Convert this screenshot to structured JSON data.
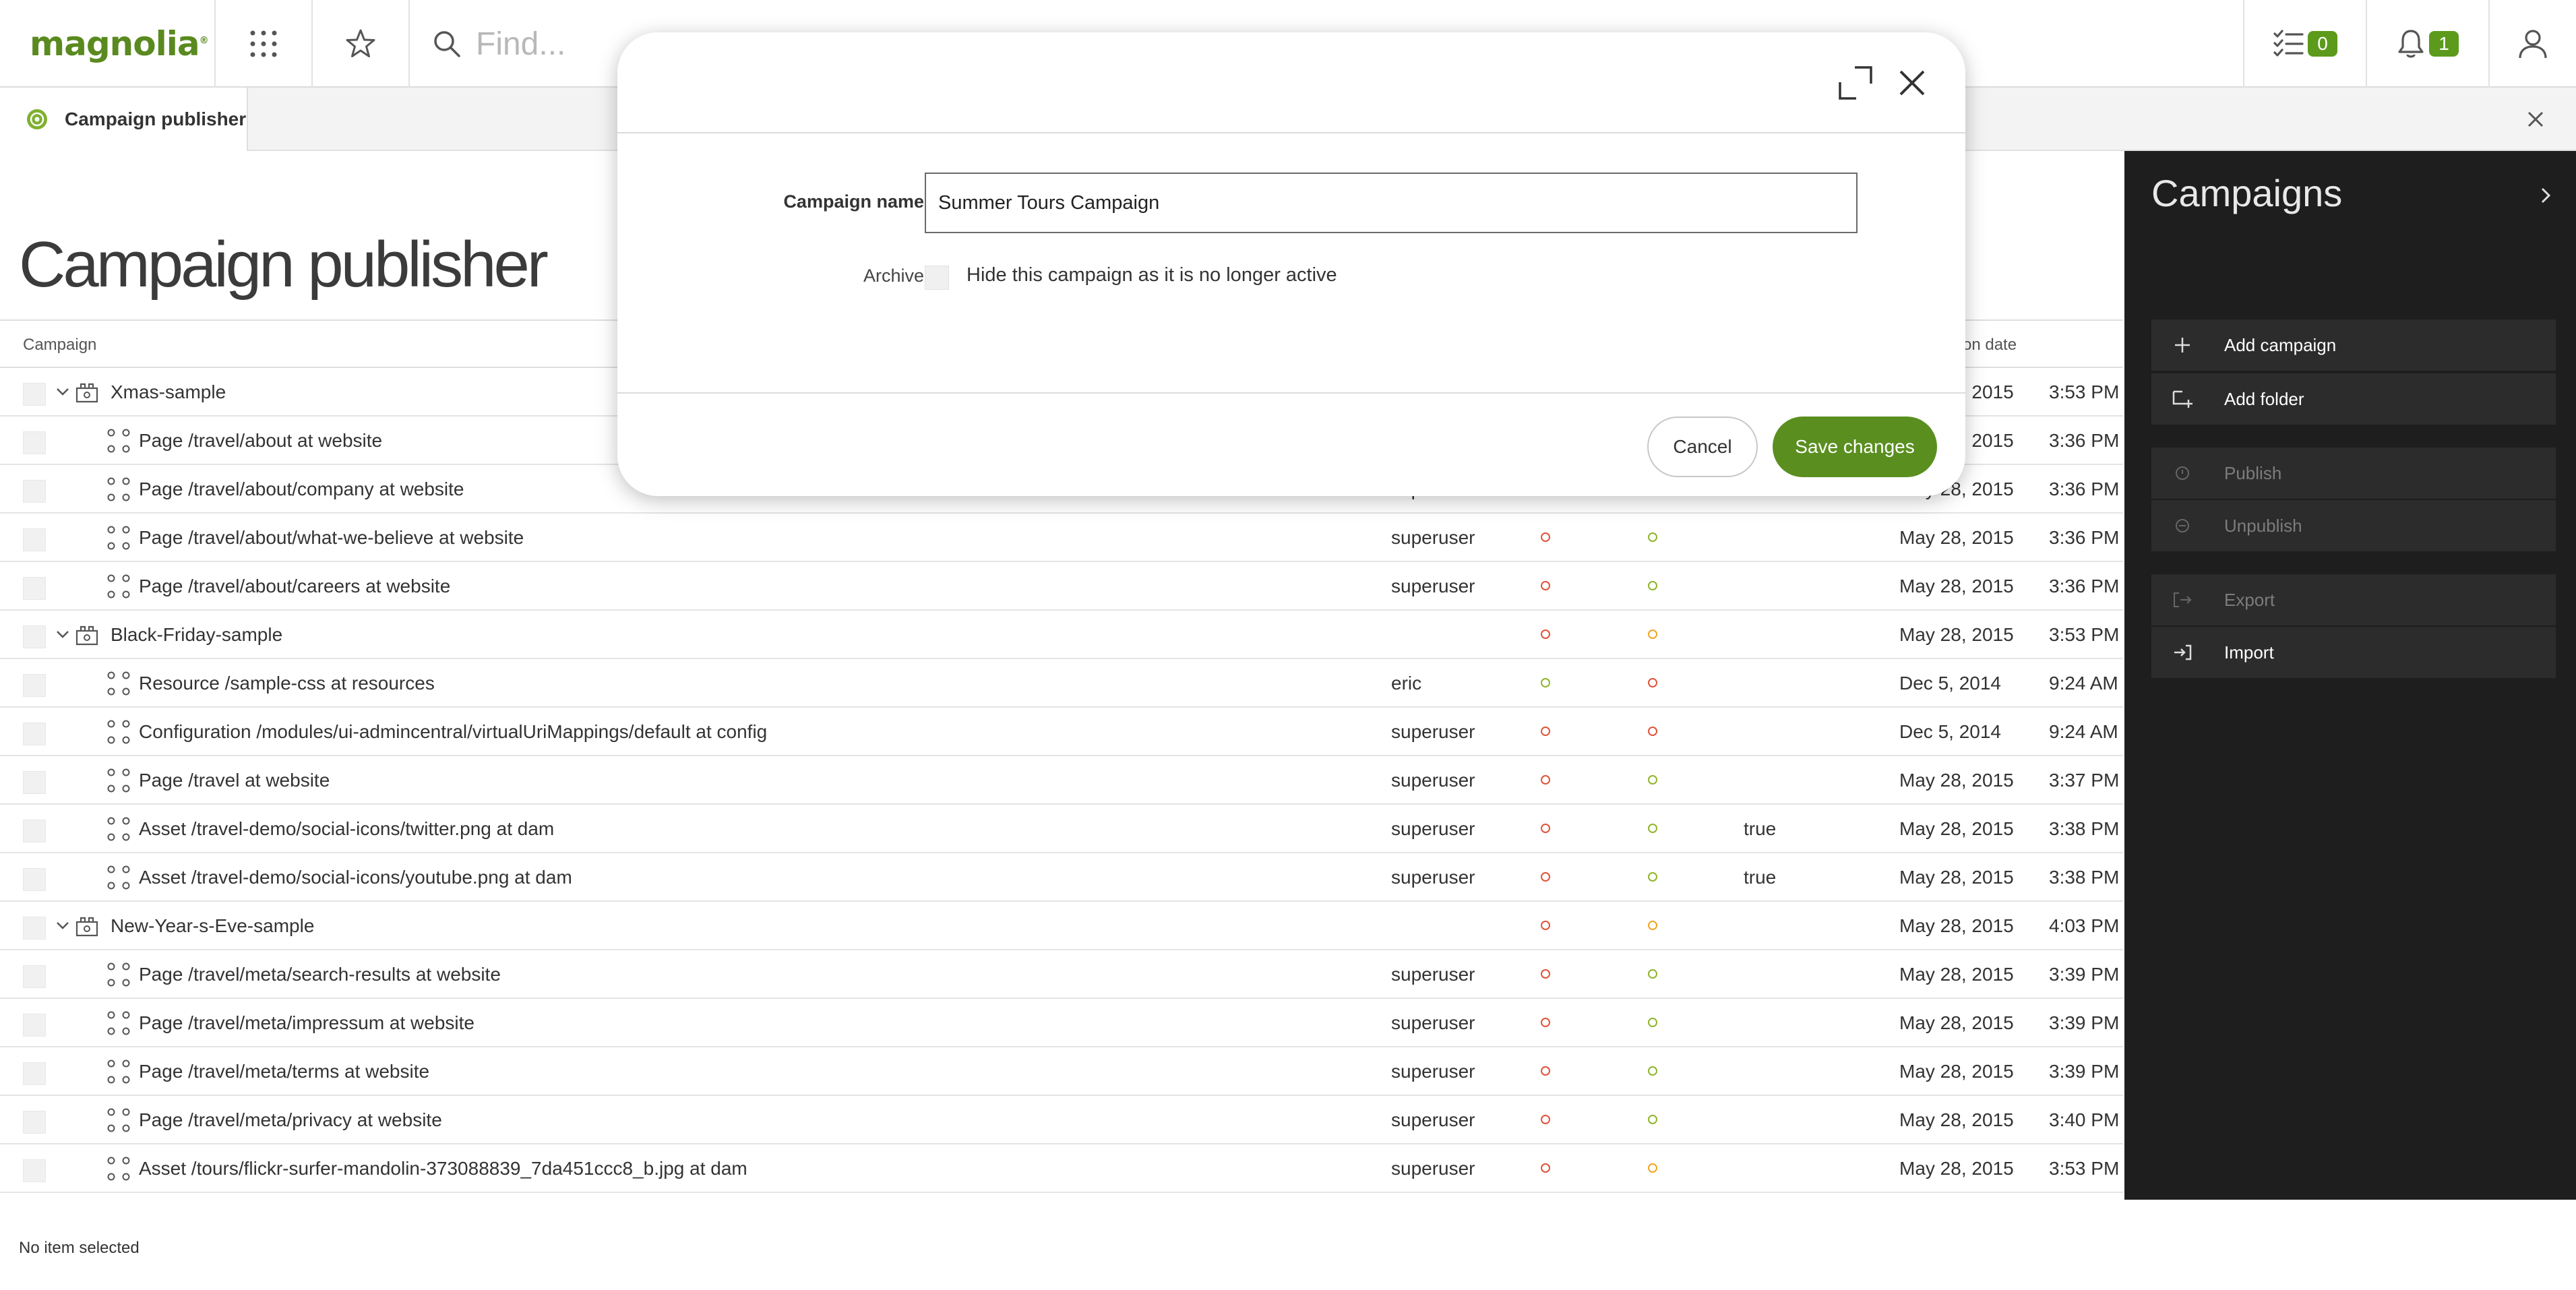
{
  "topbar": {
    "logo_text": "magnolia",
    "logo_mark": "®",
    "search_placeholder": "Find...",
    "tasks_count": "0",
    "notifications_count": "1"
  },
  "app_tab": {
    "label": "Campaign publisher"
  },
  "page": {
    "title": "Campaign publisher",
    "status": "No item selected"
  },
  "table": {
    "header_campaign": "Campaign",
    "header_date_partial": "on date",
    "rows": [
      {
        "name": "Xmas-sample",
        "type": "folder",
        "user": "",
        "dot1": "red",
        "dot2": "orange",
        "flag": "",
        "date": "May 28, 2015",
        "time": "3:53 PM"
      },
      {
        "name": "Page /travel/about at website",
        "type": "item",
        "user": "",
        "dot1": "red",
        "dot2": "green",
        "flag": "",
        "date": "May 28, 2015",
        "time": "3:36 PM"
      },
      {
        "name": "Page /travel/about/company at website",
        "type": "item",
        "user": "superuser",
        "dot1": "red",
        "dot2": "green",
        "flag": "",
        "date": "May 28, 2015",
        "time": "3:36 PM"
      },
      {
        "name": "Page /travel/about/what-we-believe at website",
        "type": "item",
        "user": "superuser",
        "dot1": "red",
        "dot2": "green",
        "flag": "",
        "date": "May 28, 2015",
        "time": "3:36 PM"
      },
      {
        "name": "Page /travel/about/careers at website",
        "type": "item",
        "user": "superuser",
        "dot1": "red",
        "dot2": "green",
        "flag": "",
        "date": "May 28, 2015",
        "time": "3:36 PM"
      },
      {
        "name": "Black-Friday-sample",
        "type": "folder",
        "user": "",
        "dot1": "red",
        "dot2": "orange",
        "flag": "",
        "date": "May 28, 2015",
        "time": "3:53 PM"
      },
      {
        "name": "Resource /sample-css at resources",
        "type": "item",
        "user": "eric",
        "dot1": "green",
        "dot2": "red",
        "flag": "",
        "date": "Dec 5, 2014",
        "time": "9:24 AM"
      },
      {
        "name": "Configuration /modules/ui-admincentral/virtualUriMappings/default at config",
        "type": "item",
        "user": "superuser",
        "dot1": "red",
        "dot2": "red",
        "flag": "",
        "date": "Dec 5, 2014",
        "time": "9:24 AM"
      },
      {
        "name": "Page /travel at website",
        "type": "item",
        "user": "superuser",
        "dot1": "red",
        "dot2": "green",
        "flag": "",
        "date": "May 28, 2015",
        "time": "3:37 PM"
      },
      {
        "name": "Asset /travel-demo/social-icons/twitter.png at dam",
        "type": "item",
        "user": "superuser",
        "dot1": "red",
        "dot2": "green",
        "flag": "true",
        "date": "May 28, 2015",
        "time": "3:38 PM"
      },
      {
        "name": "Asset /travel-demo/social-icons/youtube.png at dam",
        "type": "item",
        "user": "superuser",
        "dot1": "red",
        "dot2": "green",
        "flag": "true",
        "date": "May 28, 2015",
        "time": "3:38 PM"
      },
      {
        "name": "New-Year-s-Eve-sample",
        "type": "folder",
        "user": "",
        "dot1": "red",
        "dot2": "orange",
        "flag": "",
        "date": "May 28, 2015",
        "time": "4:03 PM"
      },
      {
        "name": "Page /travel/meta/search-results at website",
        "type": "item",
        "user": "superuser",
        "dot1": "red",
        "dot2": "green",
        "flag": "",
        "date": "May 28, 2015",
        "time": "3:39 PM"
      },
      {
        "name": "Page /travel/meta/impressum at website",
        "type": "item",
        "user": "superuser",
        "dot1": "red",
        "dot2": "green",
        "flag": "",
        "date": "May 28, 2015",
        "time": "3:39 PM"
      },
      {
        "name": "Page /travel/meta/terms at website",
        "type": "item",
        "user": "superuser",
        "dot1": "red",
        "dot2": "green",
        "flag": "",
        "date": "May 28, 2015",
        "time": "3:39 PM"
      },
      {
        "name": "Page /travel/meta/privacy at website",
        "type": "item",
        "user": "superuser",
        "dot1": "red",
        "dot2": "green",
        "flag": "",
        "date": "May 28, 2015",
        "time": "3:40 PM"
      },
      {
        "name": "Asset /tours/flickr-surfer-mandolin-373088839_7da451ccc8_b.jpg at dam",
        "type": "item",
        "user": "superuser",
        "dot1": "red",
        "dot2": "orange",
        "flag": "",
        "date": "May 28, 2015",
        "time": "3:53 PM"
      }
    ]
  },
  "panel": {
    "title": "Campaigns",
    "actions": [
      {
        "label": "Add campaign",
        "icon": "plus-icon",
        "enabled": true
      },
      {
        "label": "Add folder",
        "icon": "add-folder-icon",
        "enabled": true
      },
      {
        "label": "Publish",
        "icon": "publish-icon",
        "enabled": false
      },
      {
        "label": "Unpublish",
        "icon": "unpublish-icon",
        "enabled": false
      },
      {
        "label": "Export",
        "icon": "export-icon",
        "enabled": false
      },
      {
        "label": "Import",
        "icon": "import-icon",
        "enabled": true
      }
    ]
  },
  "dialog": {
    "campaign_name_label": "Campaign name",
    "campaign_name_value": "Summer Tours Campaign",
    "archive_label": "Archive",
    "archive_text": "Hide this campaign as it is no longer active",
    "cancel_label": "Cancel",
    "save_label": "Save changes"
  },
  "colors": {
    "brand_green": "#5a8f20",
    "status_red": "#e0533a",
    "status_green": "#8fb52a",
    "status_orange": "#f0a623",
    "panel_bg": "#1e1e1e"
  }
}
